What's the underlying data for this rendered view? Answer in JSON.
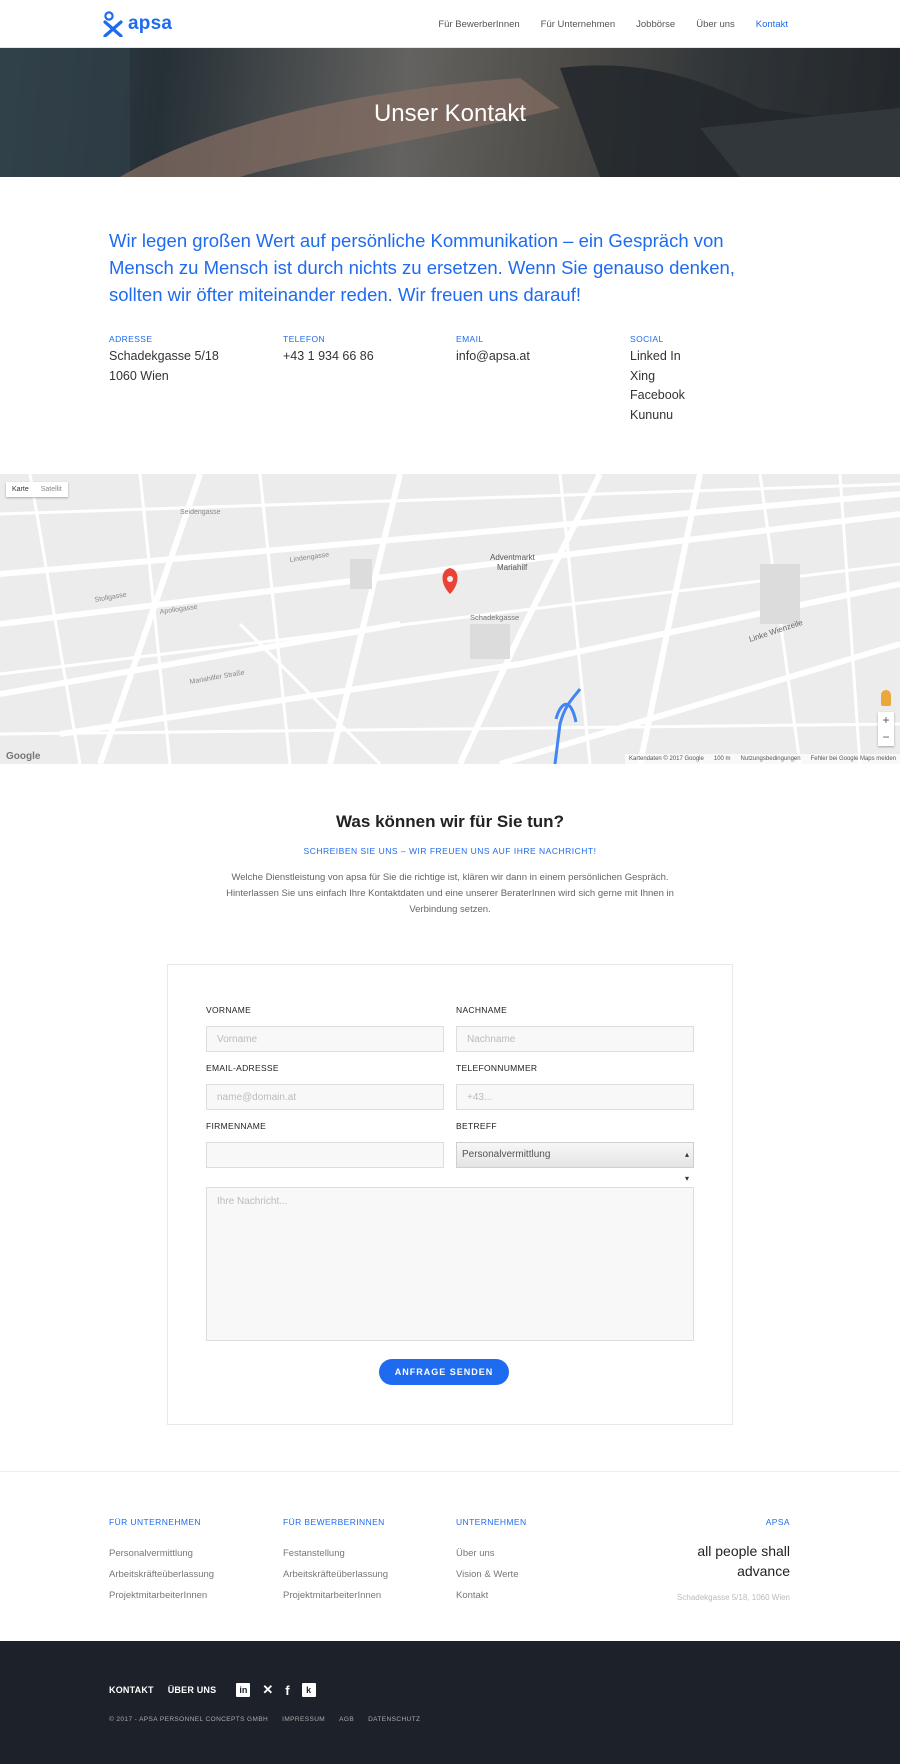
{
  "brand": {
    "name": "apsa",
    "accent": "#1f6bf0"
  },
  "nav": {
    "items": [
      {
        "label": "Für BewerberInnen",
        "active": false
      },
      {
        "label": "Für Unternehmen",
        "active": false
      },
      {
        "label": "Jobbörse",
        "active": false
      },
      {
        "label": "Über uns",
        "active": false
      },
      {
        "label": "Kontakt",
        "active": true
      }
    ]
  },
  "hero": {
    "title": "Unser Kontakt"
  },
  "intro": {
    "text": "Wir legen großen Wert auf persönliche Kommunikation – ein Gespräch von Mensch zu Mensch ist durch nichts zu ersetzen. Wenn Sie genauso denken, sollten wir öfter miteinander reden. Wir freuen uns darauf!"
  },
  "info": {
    "address": {
      "label": "Adresse",
      "line1": "Schadekgasse 5/18",
      "line2": "1060 Wien"
    },
    "phone": {
      "label": "Telefon",
      "value": "+43 1 934 66 86"
    },
    "email": {
      "label": "Email",
      "value": "info@apsa.at"
    },
    "social": {
      "label": "Social",
      "items": [
        "Linked In",
        "Xing",
        "Facebook",
        "Kununu"
      ]
    }
  },
  "map": {
    "type_options": [
      "Karte",
      "Satellit"
    ],
    "labels": {
      "market": "Adventmarkt\nMariahilf",
      "street1": "Schadekgasse",
      "street2": "Linke Wienzeile",
      "street3": "Lindengasse",
      "street4": "Mariahilfer Straße",
      "street5": "Seidengasse",
      "street6": "Stollgasse",
      "street7": "Apollogasse"
    },
    "footer": [
      "Kartendaten © 2017 Google",
      "100 m",
      "Nutzungsbedingungen",
      "Fehler bei Google Maps melden"
    ],
    "zoom_in": "+",
    "zoom_out": "−",
    "google": "Google"
  },
  "contact": {
    "title": "Was können wir für Sie tun?",
    "subtitle": "SCHREIBEN SIE UNS – WIR FREUEN UNS AUF IHRE NACHRICHT!",
    "description": "Welche Dienstleistung von apsa für Sie die richtige ist, klären wir dann in einem persönlichen Gespräch. Hinterlassen Sie uns einfach Ihre Kontaktdaten und eine unserer BeraterInnen wird sich gerne mit Ihnen in Verbindung setzen."
  },
  "form": {
    "firstname": {
      "label": "Vorname",
      "placeholder": "Vorname",
      "value": ""
    },
    "lastname": {
      "label": "Nachname",
      "placeholder": "Nachname",
      "value": ""
    },
    "email": {
      "label": "Email-Adresse",
      "placeholder": "name@domain.at",
      "value": ""
    },
    "phone": {
      "label": "Telefonnummer",
      "placeholder": "+43...",
      "value": ""
    },
    "company": {
      "label": "Firmenname",
      "placeholder": "",
      "value": ""
    },
    "subject": {
      "label": "Betreff",
      "value": "Personalvermittlung"
    },
    "message": {
      "placeholder": "Ihre Nachricht..."
    },
    "submit": "ANFRAGE SENDEN"
  },
  "footer": {
    "col1": {
      "title": "Für Unternehmen",
      "links": [
        "Personalvermittlung",
        "Arbeitskräfteüberlassung",
        "ProjektmitarbeiterInnen"
      ]
    },
    "col2": {
      "title": "Für BewerberInnen",
      "links": [
        "Festanstellung",
        "Arbeitskräfteüberlassung",
        "ProjektmitarbeiterInnen"
      ]
    },
    "col3": {
      "title": "Unternehmen",
      "links": [
        "Über uns",
        "Vision & Werte",
        "Kontakt"
      ]
    },
    "apsa": {
      "title": "APSA",
      "slogan_line1": "all people shall",
      "slogan_line2": "advance",
      "address": "Schadekgasse 5/18, 1060 Wien"
    }
  },
  "footer_bottom": {
    "links": [
      "KONTAKT",
      "ÜBER UNS"
    ],
    "social_icons": [
      "linkedin-icon",
      "xing-icon",
      "facebook-icon",
      "kununu-icon"
    ],
    "copyright": "© 2017 - APSA PERSONNEL CONCEPTS GMBH",
    "legal": [
      "IMPRESSUM",
      "AGB",
      "DATENSCHUTZ"
    ]
  }
}
